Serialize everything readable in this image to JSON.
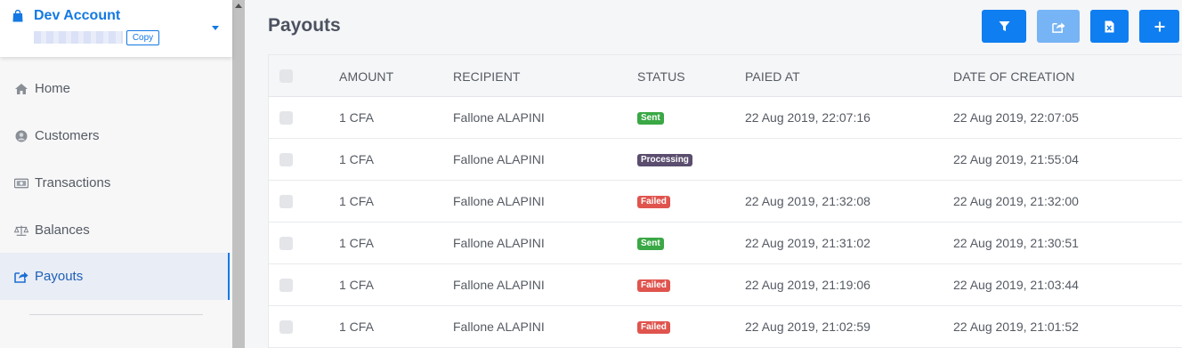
{
  "account": {
    "name": "Dev Account",
    "copy_label": "Copy"
  },
  "nav": {
    "items": [
      {
        "label": "Home",
        "icon": "home-icon"
      },
      {
        "label": "Customers",
        "icon": "user-circle-icon"
      },
      {
        "label": "Transactions",
        "icon": "money-bill-icon"
      },
      {
        "label": "Balances",
        "icon": "balance-scale-icon"
      },
      {
        "label": "Payouts",
        "icon": "share-square-icon",
        "active": true
      }
    ]
  },
  "page": {
    "title": "Payouts"
  },
  "toolbar": {
    "buttons": [
      {
        "icon": "filter-icon"
      },
      {
        "icon": "export-share-icon"
      },
      {
        "icon": "excel-file-icon"
      },
      {
        "icon": "plus-icon"
      }
    ]
  },
  "colors": {
    "accent": "#0f7ef0",
    "sent": "#3aa845",
    "processing": "#5a4d6e",
    "failed": "#e0544e"
  },
  "table": {
    "headers": {
      "amount": "AMOUNT",
      "recipient": "RECIPIENT",
      "status": "STATUS",
      "paid_at": "PAIED AT",
      "created": "DATE OF CREATION"
    },
    "rows": [
      {
        "amount": "1 CFA",
        "recipient": "Fallone ALAPINI",
        "status": "Sent",
        "paid_at": "22 Aug 2019, 22:07:16",
        "created": "22 Aug 2019, 22:07:05"
      },
      {
        "amount": "1 CFA",
        "recipient": "Fallone ALAPINI",
        "status": "Processing",
        "paid_at": "",
        "created": "22 Aug 2019, 21:55:04"
      },
      {
        "amount": "1 CFA",
        "recipient": "Fallone ALAPINI",
        "status": "Failed",
        "paid_at": "22 Aug 2019, 21:32:08",
        "created": "22 Aug 2019, 21:32:00"
      },
      {
        "amount": "1 CFA",
        "recipient": "Fallone ALAPINI",
        "status": "Sent",
        "paid_at": "22 Aug 2019, 21:31:02",
        "created": "22 Aug 2019, 21:30:51"
      },
      {
        "amount": "1 CFA",
        "recipient": "Fallone ALAPINI",
        "status": "Failed",
        "paid_at": "22 Aug 2019, 21:19:06",
        "created": "22 Aug 2019, 21:03:44"
      },
      {
        "amount": "1 CFA",
        "recipient": "Fallone ALAPINI",
        "status": "Failed",
        "paid_at": "22 Aug 2019, 21:02:59",
        "created": "22 Aug 2019, 21:01:52"
      }
    ]
  }
}
